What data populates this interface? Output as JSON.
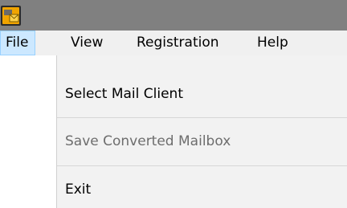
{
  "window": {
    "icon": "app-mail-icon"
  },
  "menubar": {
    "items": [
      {
        "label": "File",
        "state": "open"
      },
      {
        "label": "View"
      },
      {
        "label": "Registration"
      },
      {
        "label": "Help"
      }
    ]
  },
  "file_menu": {
    "items": [
      {
        "label": "Select Mail Client",
        "enabled": true
      },
      {
        "label": "Save Converted Mailbox",
        "enabled": false
      },
      {
        "label": "Exit",
        "enabled": true
      }
    ]
  },
  "colors": {
    "titlebar": "#808080",
    "menubar_bg": "#f0f0f0",
    "active_menu_bg": "#cce8ff",
    "dropdown_bg": "#f2f2f2",
    "disabled_text": "#6d6d6d"
  }
}
